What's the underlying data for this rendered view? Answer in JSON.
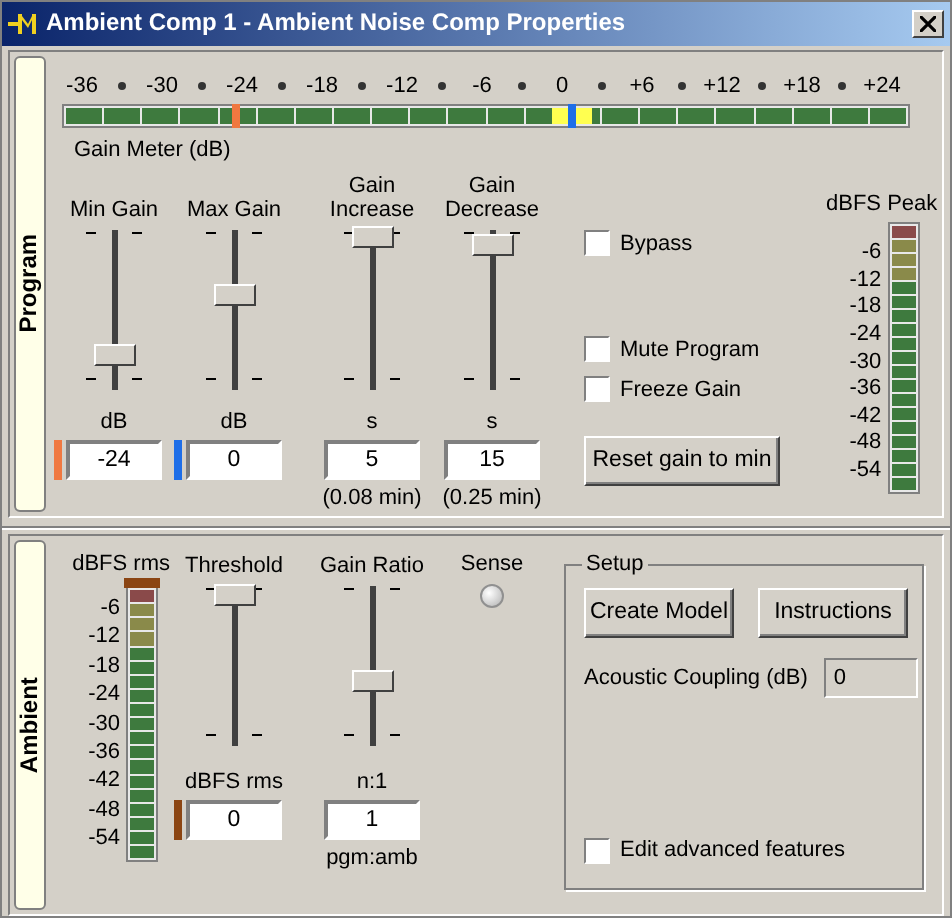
{
  "window": {
    "title": "Ambient Comp 1 - Ambient Noise Comp Properties"
  },
  "program": {
    "tab": "Program",
    "gain_meter": {
      "scale": [
        "-36",
        "-30",
        "-24",
        "-18",
        "-12",
        "-6",
        "0",
        "+6",
        "+12",
        "+18",
        "+24"
      ],
      "label": "Gain Meter (dB)",
      "markers": [
        {
          "level": 0.2,
          "color": "#f07840"
        },
        {
          "level": 0.6,
          "color": "#1e6ee8"
        }
      ],
      "current": {
        "level": 0.6
      }
    },
    "sliders": [
      {
        "label": "Min Gain",
        "unit": "dB",
        "value": "-24",
        "level": 0.18,
        "color": "#f07840"
      },
      {
        "label": "Max Gain",
        "unit": "dB",
        "value": "0",
        "level": 0.6,
        "color": "#1e6ee8"
      },
      {
        "label": "Gain Increase",
        "unit": "s",
        "value": "5",
        "note": "(0.08 min)",
        "level": 1
      },
      {
        "label": "Gain Decrease",
        "unit": "s",
        "value": "15",
        "note": "(0.25 min)",
        "level": 0.95
      }
    ],
    "checkboxes": [
      {
        "label": "Bypass",
        "checked": false
      },
      {
        "label": "Mute Program",
        "checked": false
      },
      {
        "label": "Freeze Gain",
        "checked": false
      }
    ],
    "reset_button": "Reset gain to min",
    "peak_meter": {
      "label": "dBFS Peak",
      "scale": [
        "-6",
        "-12",
        "-18",
        "-24",
        "-30",
        "-36",
        "-42",
        "-48",
        "-54"
      ]
    }
  },
  "ambient": {
    "tab": "Ambient",
    "rms_meter": {
      "label": "dBFS rms",
      "scale": [
        "-6",
        "-12",
        "-18",
        "-24",
        "-30",
        "-36",
        "-42",
        "-48",
        "-54"
      ],
      "clip": true
    },
    "threshold": {
      "label": "Threshold",
      "unit": "dBFS rms",
      "value": "0",
      "level": 0.98,
      "color": "#8b4513"
    },
    "ratio": {
      "label": "Gain Ratio",
      "unit": "n:1",
      "value": "1",
      "note": "pgm:amb",
      "level": 0.4
    },
    "sense": {
      "label": "Sense",
      "on": false
    },
    "setup": {
      "title": "Setup",
      "buttons": [
        "Create Model",
        "Instructions"
      ],
      "coupling": {
        "label": "Acoustic Coupling (dB)",
        "value": "0"
      },
      "advanced": {
        "label": "Edit advanced features",
        "checked": false
      }
    }
  }
}
